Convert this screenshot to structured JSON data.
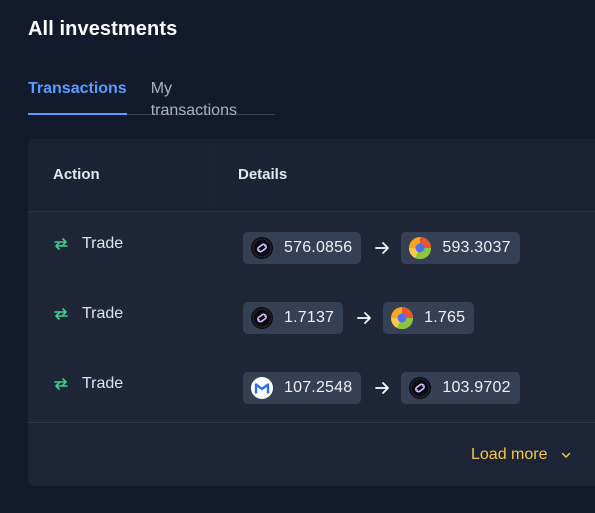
{
  "page": {
    "title": "All investments"
  },
  "tabs": [
    {
      "label": "Transactions",
      "active": true
    },
    {
      "label": "My transactions",
      "active": false
    }
  ],
  "table": {
    "columns": {
      "action": "Action",
      "details": "Details"
    },
    "rows": [
      {
        "action": "Trade",
        "from": {
          "icon": "purple-token-icon",
          "amount": "576.0856"
        },
        "to": {
          "icon": "orange-green-token-icon",
          "amount": "593.3037"
        }
      },
      {
        "action": "Trade",
        "from": {
          "icon": "purple-token-icon",
          "amount": "1.7137"
        },
        "to": {
          "icon": "orange-green-token-icon",
          "amount": "1.765"
        }
      },
      {
        "action": "Trade",
        "from": {
          "icon": "blue-m-token-icon",
          "amount": "107.2548"
        },
        "to": {
          "icon": "purple-token-icon",
          "amount": "103.9702"
        }
      }
    ],
    "load_more": "Load more"
  },
  "colors": {
    "accent": "#5b9dff",
    "trade_icon": "#3fcf8e",
    "load_more": "#f2c94c"
  }
}
